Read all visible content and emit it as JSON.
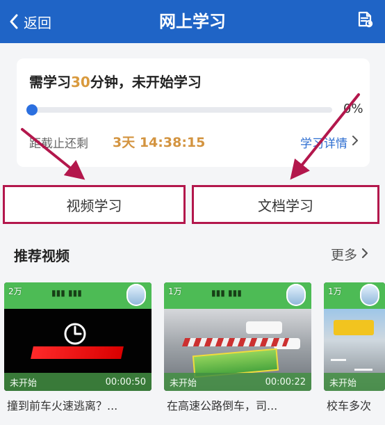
{
  "header": {
    "back_label": "返回",
    "title": "网上学习",
    "colors": {
      "bar": "#1f64c6",
      "text": "#ffffff"
    }
  },
  "status": {
    "need_prefix": "需学习",
    "need_minutes": "30",
    "need_suffix": "分钟，未开始学习",
    "progress": {
      "value": 0,
      "label": "0%"
    },
    "deadline_label": "距截止还剩",
    "deadline_value": "3天 14:38:15",
    "detail_label": "学习详情"
  },
  "tabs": [
    {
      "label": "视频学习"
    },
    {
      "label": "文档学习"
    }
  ],
  "section": {
    "title": "推荐视频",
    "more_label": "更多"
  },
  "videos": [
    {
      "views": "2万",
      "status": "未开始",
      "duration": "00:00:50",
      "title": "撞到前车火速逃离？...",
      "scene": "black"
    },
    {
      "views": "1万",
      "status": "未开始",
      "duration": "00:00:22",
      "title": "在高速公路倒车，司...",
      "scene": "street"
    },
    {
      "views": "1万",
      "status": "未开始",
      "duration": "",
      "title": "校车多次",
      "scene": "road"
    }
  ],
  "icons": {
    "back": "chevron-left-icon",
    "document": "document-icon",
    "detail": "chevron-right-icon",
    "more": "chevron-right-icon",
    "annotation_arrow": "arrow-icon"
  },
  "colors": {
    "accent": "#d99a3e",
    "progress": "#2b6fdf",
    "annotation": "#b3174c",
    "detail_link": "#2f6fd1"
  }
}
